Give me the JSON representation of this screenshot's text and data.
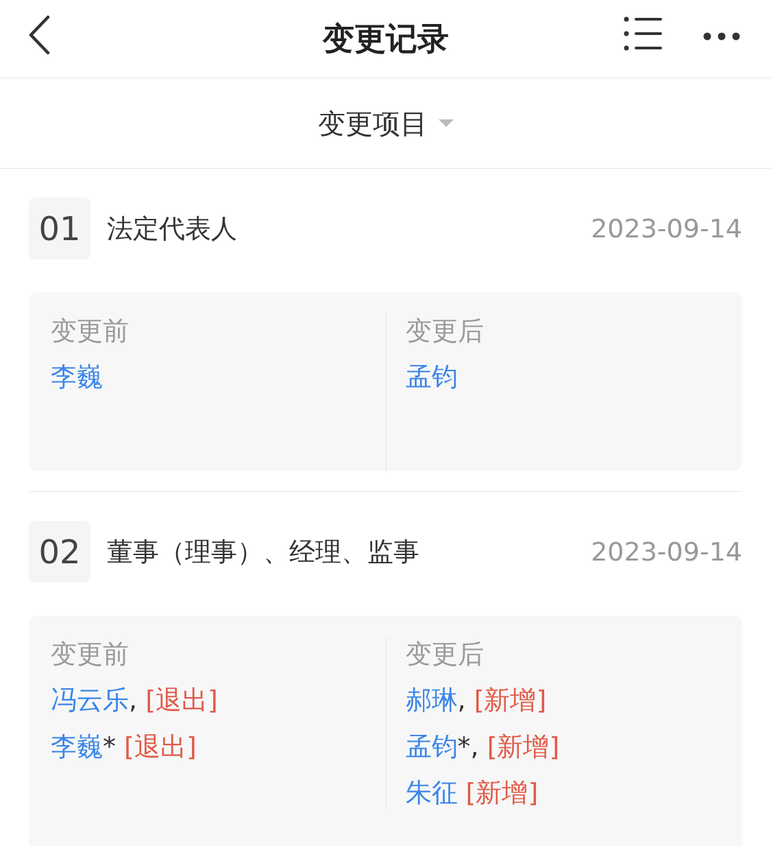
{
  "header": {
    "title": "变更记录"
  },
  "filter": {
    "label": "变更项目"
  },
  "records": [
    {
      "number": "01",
      "item": "法定代表人",
      "date": "2023-09-14",
      "before_label": "变更前",
      "after_label": "变更后",
      "before": [
        {
          "name": "李巍"
        }
      ],
      "after": [
        {
          "name": "孟钧"
        }
      ]
    },
    {
      "number": "02",
      "item": "董事（理事）、经理、监事",
      "date": "2023-09-14",
      "before_label": "变更前",
      "after_label": "变更后",
      "before": [
        {
          "name": "冯云乐",
          "suffix": ",",
          "tag": "[退出]"
        },
        {
          "name": "李巍",
          "suffix": "*",
          "tag": "[退出]"
        }
      ],
      "after": [
        {
          "name": "郝琳",
          "suffix": ",",
          "tag": "[新增]"
        },
        {
          "name": "孟钧",
          "suffix": "*,",
          "tag": "[新增]"
        },
        {
          "name": "朱征",
          "tag": "[新增]"
        }
      ]
    }
  ]
}
